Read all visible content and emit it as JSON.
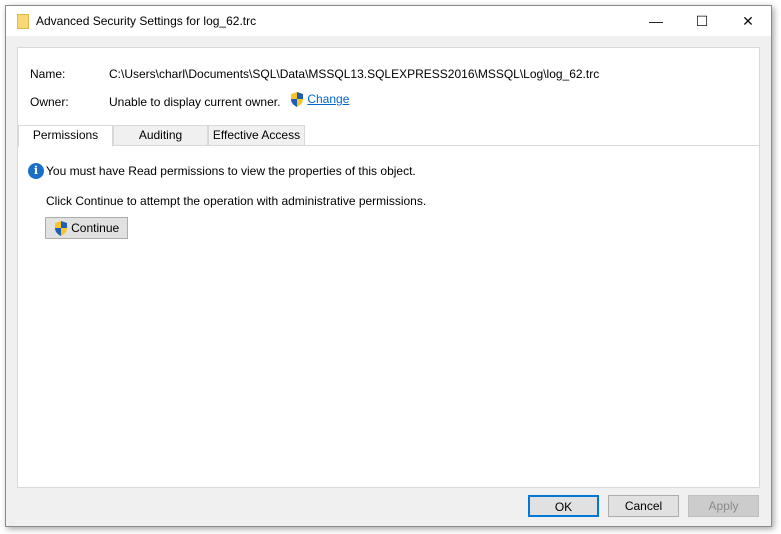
{
  "window": {
    "title": "Advanced Security Settings for log_62.trc",
    "minimize": "—",
    "maximize": "☐",
    "close": "✕"
  },
  "fields": {
    "name_label": "Name:",
    "name_value": "C:\\Users\\charl\\Documents\\SQL\\Data\\MSSQL13.SQLEXPRESS2016\\MSSQL\\Log\\log_62.trc",
    "owner_label": "Owner:",
    "owner_value": "Unable to display current owner.",
    "change_link": "Change"
  },
  "tabs": [
    {
      "label": "Permissions",
      "active": true
    },
    {
      "label": "Auditing"
    },
    {
      "label": "Effective Access"
    }
  ],
  "content": {
    "info_icon": "i",
    "message": "You must have Read permissions to view the properties of this object.",
    "instruction": "Click Continue to attempt the operation with administrative permissions.",
    "continue_button": "Continue"
  },
  "footer": {
    "ok": "OK",
    "cancel": "Cancel",
    "apply": "Apply"
  },
  "colors": {
    "accent": "#0078d7",
    "link": "#0066cc"
  }
}
